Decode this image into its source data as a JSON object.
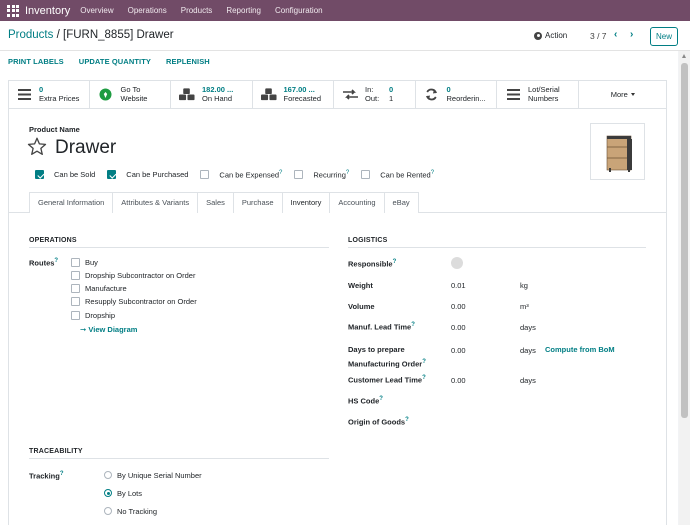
{
  "navbar": {
    "app_name": "Inventory",
    "menus": [
      "Overview",
      "Operations",
      "Products",
      "Reporting",
      "Configuration"
    ]
  },
  "control_panel": {
    "breadcrumb_parent": "Products",
    "breadcrumb_sep": "/",
    "breadcrumb_current": "[FURN_8855] Drawer",
    "action_label": "Action",
    "pager": "3 / 7",
    "new_label": "New"
  },
  "header_buttons": [
    "PRINT LABELS",
    "UPDATE QUANTITY",
    "REPLENISH"
  ],
  "stat_buttons": [
    {
      "icon": "list-icon",
      "value": "0",
      "label": "Extra Prices"
    },
    {
      "icon": "globe-icon",
      "value": "Go To",
      "label": "Website"
    },
    {
      "icon": "cubes-icon",
      "value": "182.00 ...",
      "label": "On Hand"
    },
    {
      "icon": "cubes-icon",
      "value": "167.00 ...",
      "label": "Forecasted"
    },
    {
      "icon": "exchange-icon",
      "in_label": "In:",
      "in_value": "0",
      "out_label": "Out:",
      "out_value": "1"
    },
    {
      "icon": "refresh-icon",
      "value": "0",
      "label": "Reorderin..."
    },
    {
      "icon": "bars-icon",
      "value": "Lot/Serial",
      "label": "Numbers"
    },
    {
      "label": "More"
    }
  ],
  "product": {
    "name_label": "Product Name",
    "name": "Drawer",
    "flags": [
      {
        "label": "Can be Sold",
        "checked": true
      },
      {
        "label": "Can be Purchased",
        "checked": true
      },
      {
        "label": "Can be Expensed",
        "checked": false,
        "help": "?"
      },
      {
        "label": "Recurring",
        "checked": false,
        "help": "?"
      },
      {
        "label": "Can be Rented",
        "checked": false,
        "help": "?"
      }
    ]
  },
  "tabs": [
    "General Information",
    "Attributes & Variants",
    "Sales",
    "Purchase",
    "Inventory",
    "Accounting",
    "eBay"
  ],
  "active_tab": "Inventory",
  "operations": {
    "title": "OPERATIONS",
    "routes_label": "Routes",
    "routes": [
      "Buy",
      "Dropship Subcontractor on Order",
      "Manufacture",
      "Resupply Subcontractor on Order",
      "Dropship"
    ],
    "view_diagram": "View Diagram"
  },
  "logistics": {
    "title": "LOGISTICS",
    "responsible_label": "Responsible",
    "weight_label": "Weight",
    "weight_value": "0.01",
    "weight_unit": "kg",
    "volume_label": "Volume",
    "volume_value": "0.00",
    "volume_unit": "m³",
    "manuf_lead_label": "Manuf. Lead Time",
    "manuf_lead_value": "0.00",
    "manuf_lead_unit": "days",
    "days_prepare_label_1": "Days to prepare",
    "days_prepare_label_2": "Manufacturing Order",
    "days_prepare_value": "0.00",
    "days_prepare_unit": "days",
    "compute_bom": "Compute from BoM",
    "customer_lead_label": "Customer Lead Time",
    "customer_lead_value": "0.00",
    "customer_lead_unit": "days",
    "hs_code_label": "HS Code",
    "origin_label": "Origin of Goods",
    "help": "?"
  },
  "traceability": {
    "title": "TRACEABILITY",
    "tracking_label": "Tracking",
    "options": [
      "By Unique Serial Number",
      "By Lots",
      "No Tracking"
    ],
    "selected": "By Lots"
  },
  "colors": {
    "brand": "#714b67",
    "accent": "#017e84"
  }
}
